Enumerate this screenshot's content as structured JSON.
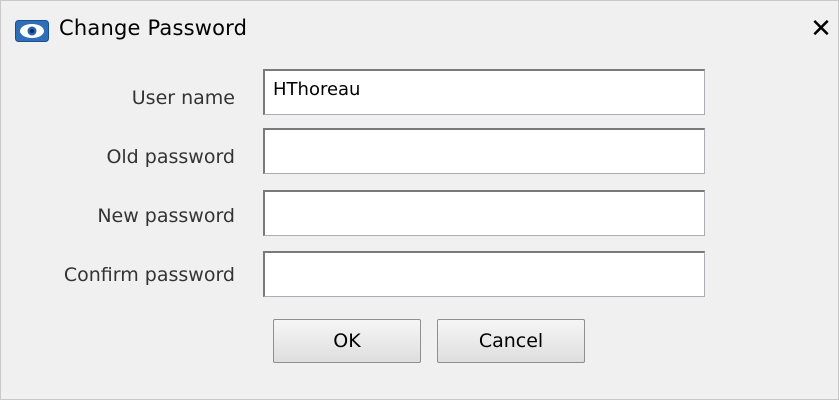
{
  "window": {
    "title": "Change Password",
    "close_symbol": "✕",
    "icon": "eye-icon"
  },
  "form": {
    "user_name": {
      "label": "User name",
      "value": "HThoreau"
    },
    "old_password": {
      "label": "Old password",
      "value": ""
    },
    "new_password": {
      "label": "New password",
      "value": ""
    },
    "confirm_password": {
      "label": "Confirm password",
      "value": ""
    }
  },
  "buttons": {
    "ok_label": "OK",
    "cancel_label": "Cancel"
  }
}
